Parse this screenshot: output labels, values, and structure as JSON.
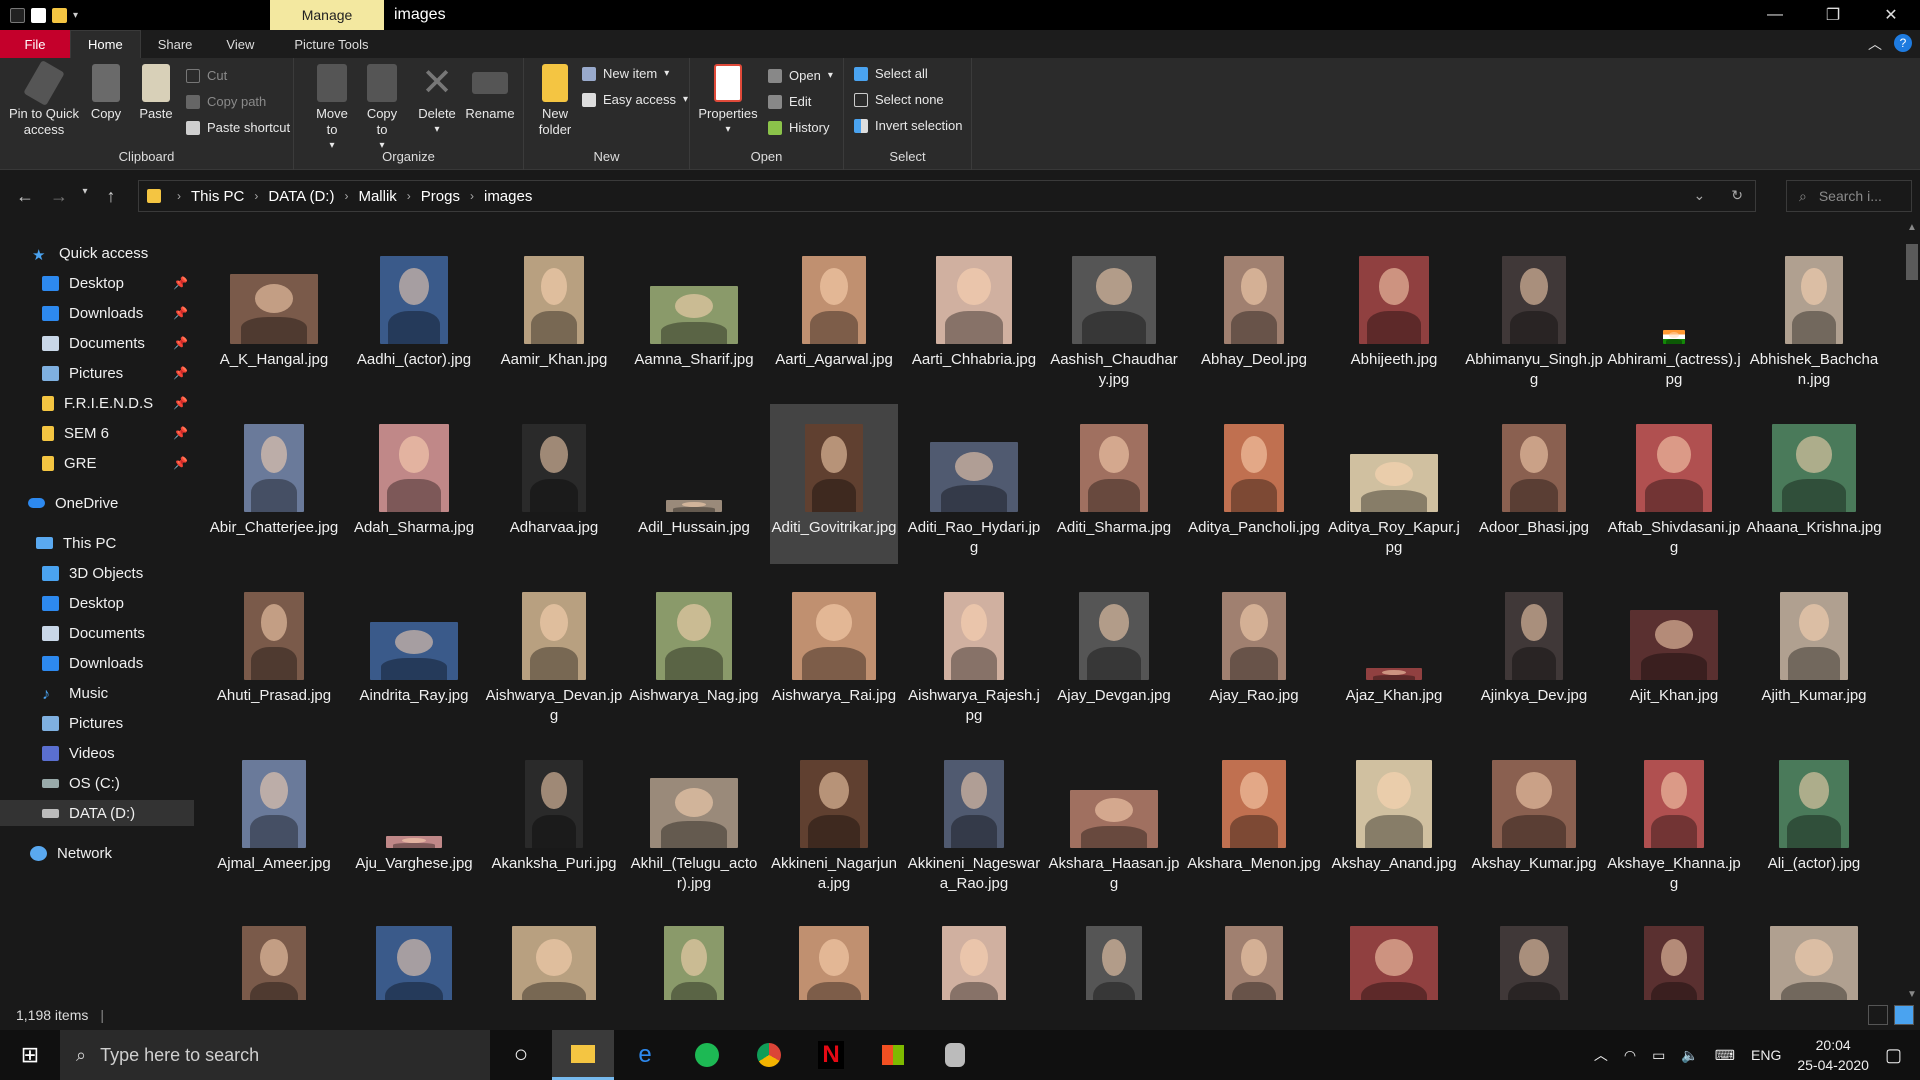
{
  "window": {
    "title": "images",
    "context_tab": "Manage"
  },
  "tabs": [
    "File",
    "Home",
    "Share",
    "View",
    "Picture Tools"
  ],
  "ribbon": {
    "clipboard": {
      "label": "Clipboard",
      "pin": "Pin to Quick access",
      "copy": "Copy",
      "paste": "Paste",
      "cut": "Cut",
      "copy_path": "Copy path",
      "paste_shortcut": "Paste shortcut"
    },
    "organize": {
      "label": "Organize",
      "move_to": "Move to",
      "copy_to": "Copy to",
      "delete": "Delete",
      "rename": "Rename"
    },
    "new": {
      "label": "New",
      "new_folder": "New folder",
      "new_item": "New item",
      "easy_access": "Easy access"
    },
    "open": {
      "label": "Open",
      "properties": "Properties",
      "open": "Open",
      "edit": "Edit",
      "history": "History"
    },
    "select": {
      "label": "Select",
      "select_all": "Select all",
      "select_none": "Select none",
      "invert": "Invert selection"
    }
  },
  "address": {
    "crumbs": [
      "This PC",
      "DATA (D:)",
      "Mallik",
      "Progs",
      "images"
    ]
  },
  "search": {
    "placeholder": "Search i..."
  },
  "sidebar": {
    "quick_access": "Quick access",
    "pinned": [
      "Desktop",
      "Downloads",
      "Documents",
      "Pictures",
      "F.R.I.E.N.D.S",
      "SEM 6",
      "GRE"
    ],
    "onedrive": "OneDrive",
    "this_pc": "This PC",
    "pc_items": [
      "3D Objects",
      "Desktop",
      "Documents",
      "Downloads",
      "Music",
      "Pictures",
      "Videos",
      "OS (C:)",
      "DATA (D:)"
    ],
    "network": "Network"
  },
  "files": [
    "A_K_Hangal.jpg",
    "Aadhi_(actor).jpg",
    "Aamir_Khan.jpg",
    "Aamna_Sharif.jpg",
    "Aarti_Agarwal.jpg",
    "Aarti_Chhabria.jpg",
    "Aashish_Chaudhary.jpg",
    "Abhay_Deol.jpg",
    "Abhijeeth.jpg",
    "Abhimanyu_Singh.jpg",
    "Abhirami_(actress).jpg",
    "Abhishek_Bachchan.jpg",
    "Abir_Chatterjee.jpg",
    "Adah_Sharma.jpg",
    "Adharvaa.jpg",
    "Adil_Hussain.jpg",
    "Aditi_Govitrikar.jpg",
    "Aditi_Rao_Hydari.jpg",
    "Aditi_Sharma.jpg",
    "Aditya_Pancholi.jpg",
    "Aditya_Roy_Kapur.jpg",
    "Adoor_Bhasi.jpg",
    "Aftab_Shivdasani.jpg",
    "Ahaana_Krishna.jpg",
    "Ahuti_Prasad.jpg",
    "Aindrita_Ray.jpg",
    "Aishwarya_Devan.jpg",
    "Aishwarya_Nag.jpg",
    "Aishwarya_Rai.jpg",
    "Aishwarya_Rajesh.jpg",
    "Ajay_Devgan.jpg",
    "Ajay_Rao.jpg",
    "Ajaz_Khan.jpg",
    "Ajinkya_Dev.jpg",
    "Ajit_Khan.jpg",
    "Ajith_Kumar.jpg",
    "Ajmal_Ameer.jpg",
    "Aju_Varghese.jpg",
    "Akanksha_Puri.jpg",
    "Akhil_(Telugu_actor).jpg",
    "Akkineni_Nagarjuna.jpg",
    "Akkineni_Nageswara_Rao.jpg",
    "Akshara_Haasan.jpg",
    "Akshara_Menon.jpg",
    "Akshay_Anand.jpg",
    "Akshay_Kumar.jpg",
    "Akshaye_Khanna.jpg",
    "Ali_(actor).jpg",
    "",
    "",
    "",
    "",
    "",
    "",
    "",
    "",
    "",
    "",
    "",
    ""
  ],
  "status": {
    "count": "1,198 items"
  },
  "taskbar": {
    "search_placeholder": "Type here to search",
    "lang": "ENG",
    "time": "20:04",
    "date": "25-04-2020"
  }
}
